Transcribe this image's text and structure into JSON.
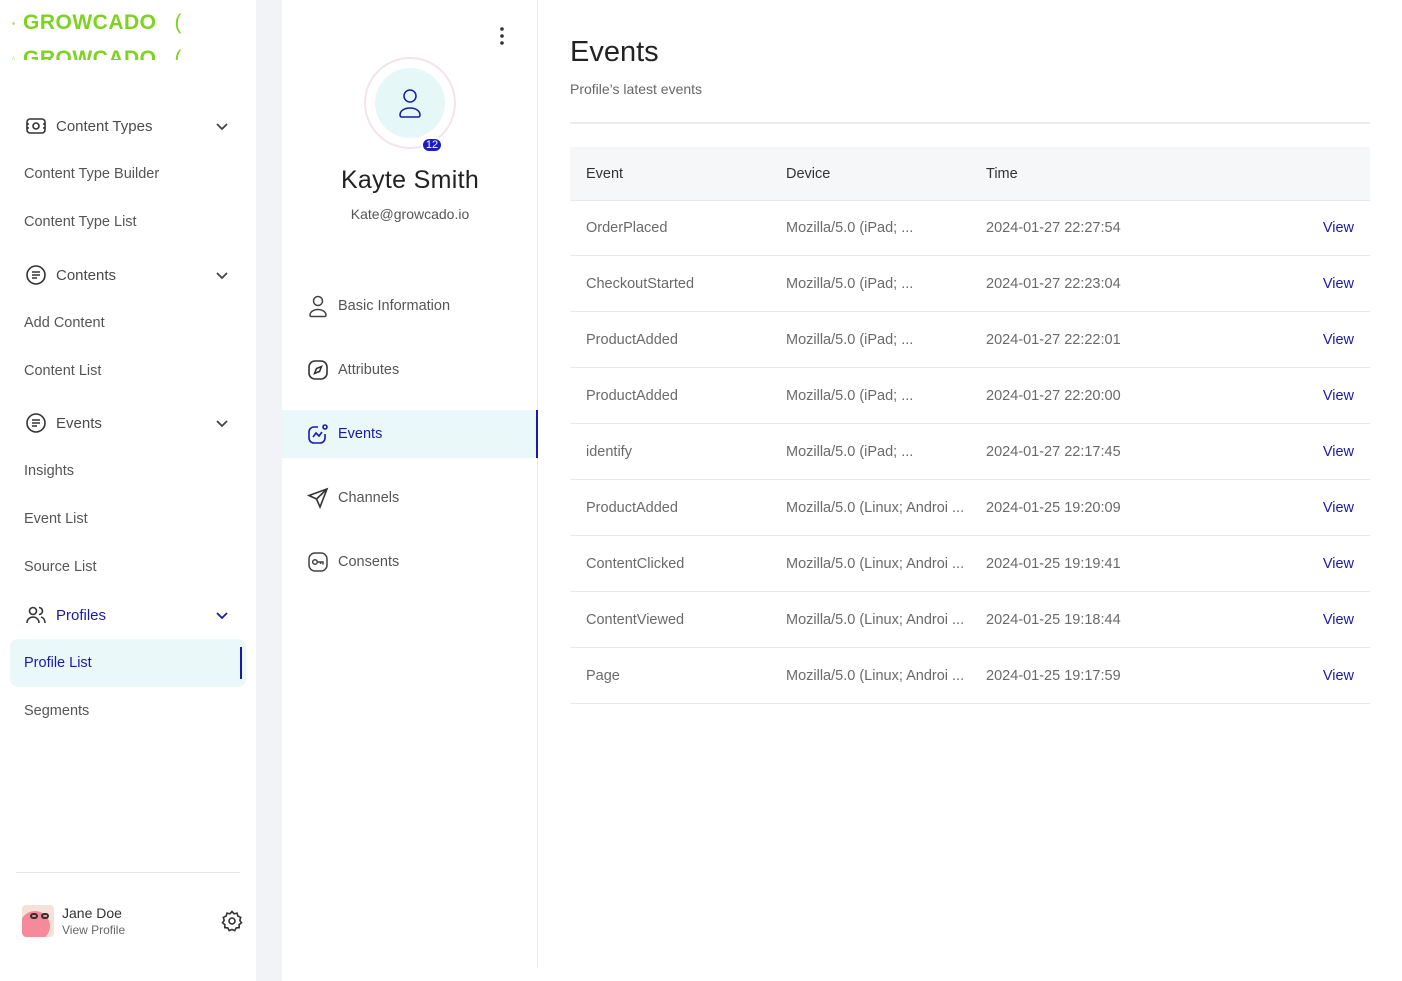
{
  "brand": {
    "name": "GROWCADO",
    "color": "#7ed321",
    "paren": "("
  },
  "sidebar": {
    "groups": [
      {
        "label": "Content Types",
        "icon": "content-types-icon",
        "items": [
          "Content Type Builder",
          "Content Type List"
        ]
      },
      {
        "label": "Contents",
        "icon": "contents-icon",
        "items": [
          "Add Content",
          "Content List"
        ]
      },
      {
        "label": "Events",
        "icon": "events-icon",
        "items": [
          "Insights",
          "Event List",
          "Source List"
        ]
      },
      {
        "label": "Profiles",
        "icon": "profiles-icon",
        "items": [
          "Profile List",
          "Segments"
        ],
        "active": true,
        "selected_item": "Profile List"
      }
    ],
    "user": {
      "name": "Jane Doe",
      "link": "View Profile"
    }
  },
  "profile": {
    "name": "Kayte Smith",
    "email": "Kate@growcado.io",
    "badge_count": "12",
    "menu": [
      {
        "label": "Basic Information",
        "icon": "user-icon"
      },
      {
        "label": "Attributes",
        "icon": "compass-icon"
      },
      {
        "label": "Events",
        "icon": "activity-icon",
        "selected": true
      },
      {
        "label": "Channels",
        "icon": "send-icon"
      },
      {
        "label": "Consents",
        "icon": "key-icon"
      }
    ]
  },
  "main": {
    "title": "Events",
    "subtitle": "Profile’s latest events",
    "columns": [
      "Event",
      "Device",
      "Time"
    ],
    "rows": [
      {
        "event": "OrderPlaced",
        "device": "Mozilla/5.0 (iPad; ...",
        "time": "2024-01-27 22:27:54",
        "action": "View"
      },
      {
        "event": "CheckoutStarted",
        "device": "Mozilla/5.0 (iPad; ...",
        "time": "2024-01-27 22:23:04",
        "action": "View"
      },
      {
        "event": "ProductAdded",
        "device": "Mozilla/5.0 (iPad; ...",
        "time": "2024-01-27 22:22:01",
        "action": "View"
      },
      {
        "event": "ProductAdded",
        "device": "Mozilla/5.0 (iPad; ...",
        "time": "2024-01-27 22:20:00",
        "action": "View"
      },
      {
        "event": "identify",
        "device": "Mozilla/5.0 (iPad; ...",
        "time": "2024-01-27 22:17:45",
        "action": "View"
      },
      {
        "event": "ProductAdded",
        "device": "Mozilla/5.0 (Linux; Androi ...",
        "time": "2024-01-25 19:20:09",
        "action": "View"
      },
      {
        "event": "ContentClicked",
        "device": "Mozilla/5.0 (Linux; Androi ...",
        "time": "2024-01-25 19:19:41",
        "action": "View"
      },
      {
        "event": "ContentViewed",
        "device": "Mozilla/5.0 (Linux; Androi ...",
        "time": "2024-01-25 19:18:44",
        "action": "View"
      },
      {
        "event": "Page",
        "device": "Mozilla/5.0 (Linux; Androi ...",
        "time": "2024-01-25 19:17:59",
        "action": "View"
      }
    ]
  },
  "colors": {
    "accent": "#1a1aa6",
    "selected_bg": "#eaf8f9",
    "badge": "#1d1dbd"
  }
}
